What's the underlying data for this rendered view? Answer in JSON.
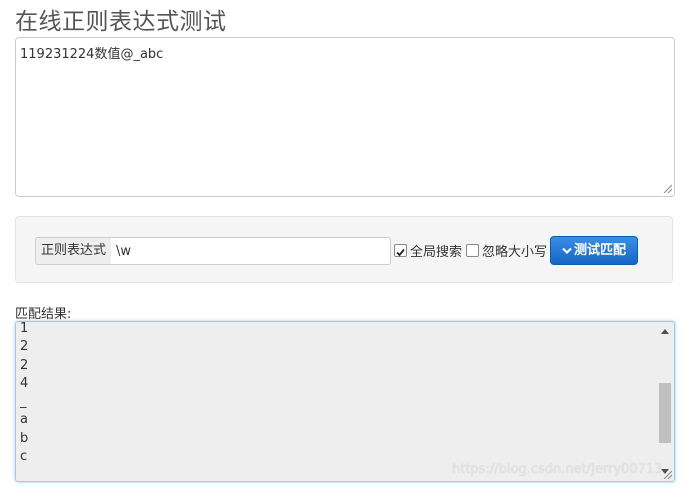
{
  "page": {
    "title": "在线正则表达式测试"
  },
  "source": {
    "text": "119231224数值@_abc"
  },
  "controls": {
    "regex_label": "正则表达式",
    "regex_value": "\\w",
    "global_search": {
      "label": "全局搜索",
      "checked": true
    },
    "ignore_case": {
      "label": "忽略大小写",
      "checked": false
    },
    "test_button_label": "测试匹配",
    "test_button_icon": "chevron-down-icon"
  },
  "result": {
    "label": "匹配结果:",
    "lines": [
      "1",
      "2",
      "2",
      "4",
      "_",
      "a",
      "b",
      "c"
    ],
    "scrollbar": true
  },
  "colors": {
    "accent": "#1567c4",
    "panel_bg": "#f5f5f5",
    "result_bg": "#eeeeee",
    "result_border": "#9ecaed"
  },
  "watermark": {
    "text": "https://blog.csdn.net/Jerry00713"
  }
}
